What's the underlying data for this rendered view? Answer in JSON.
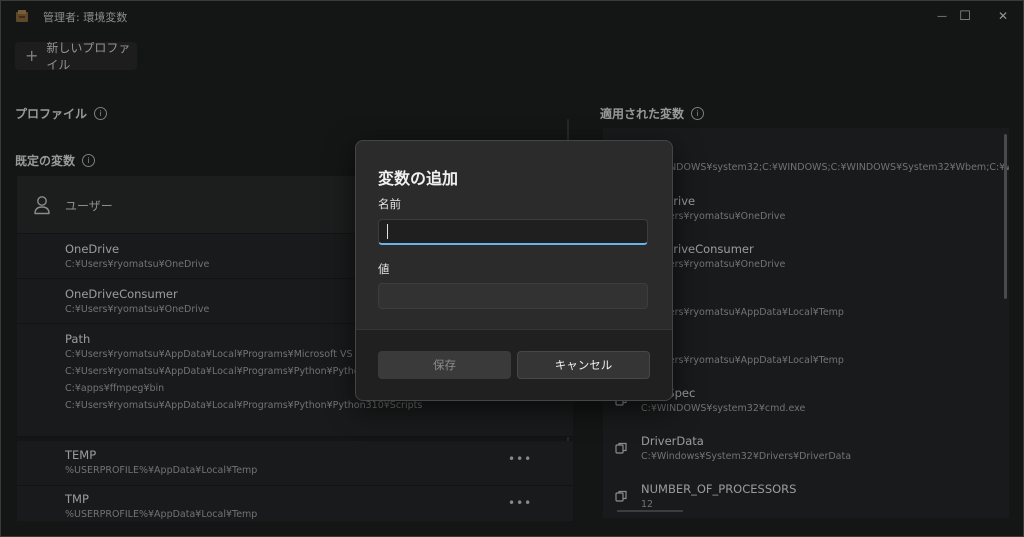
{
  "window": {
    "title": "管理者: 環境変数"
  },
  "window_controls": {
    "minimize": "—",
    "maximize": "☐",
    "close": "✕"
  },
  "toolbar": {
    "new_profile_label": "新しいプロファイル",
    "plus_icon": "+"
  },
  "sections": {
    "profile": "プロファイル",
    "default_vars": "既定の変数",
    "applied_vars": "適用された変数",
    "info_glyph": "i"
  },
  "left_panel": {
    "user_label": "ユーザー",
    "more_glyph": "•••",
    "rows": [
      {
        "name": "OneDrive",
        "values": [
          "C:¥Users¥ryomatsu¥OneDrive"
        ]
      },
      {
        "name": "OneDriveConsumer",
        "values": [
          "C:¥Users¥ryomatsu¥OneDrive"
        ]
      },
      {
        "name": "Path",
        "values": [
          "C:¥Users¥ryomatsu¥AppData¥Local¥Programs¥Microsoft VS Code",
          "C:¥Users¥ryomatsu¥AppData¥Local¥Programs¥Python¥Python3",
          "C:¥apps¥ffmpeg¥bin",
          "C:¥Users¥ryomatsu¥AppData¥Local¥Programs¥Python¥Python310¥Scripts"
        ]
      },
      {
        "name": "TEMP",
        "values": [
          "%USERPROFILE%¥AppData¥Local¥Temp"
        ]
      },
      {
        "name": "TMP",
        "values": [
          "%USERPROFILE%¥AppData¥Local¥Temp"
        ]
      }
    ]
  },
  "right_panel": {
    "rows": [
      {
        "name": "",
        "value": "C:¥WINDOWS¥system32;C:¥WINDOWS;C:¥WINDOWS¥System32¥Wbem;C:¥WINDO"
      },
      {
        "name": "OneDrive",
        "value": "C:¥Users¥ryomatsu¥OneDrive"
      },
      {
        "name": "OneDriveConsumer",
        "value": "C:¥Users¥ryomatsu¥OneDrive"
      },
      {
        "name": "",
        "value": "C:¥Users¥ryomatsu¥AppData¥Local¥Temp"
      },
      {
        "name": "",
        "value": "C:¥Users¥ryomatsu¥AppData¥Local¥Temp"
      },
      {
        "name": "ComSpec",
        "value": "C:¥WINDOWS¥system32¥cmd.exe"
      },
      {
        "name": "DriverData",
        "value": "C:¥Windows¥System32¥Drivers¥DriverData"
      },
      {
        "name": "NUMBER_OF_PROCESSORS",
        "value": "12"
      }
    ]
  },
  "dialog": {
    "title": "変数の追加",
    "name_label": "名前",
    "name_value": "",
    "value_label": "値",
    "value_value": "",
    "save_label": "保存",
    "cancel_label": "キャンセル"
  },
  "colors": {
    "accent": "#6ab3ea",
    "background": "#1e1f20",
    "dialog": "#2b2b2b"
  }
}
